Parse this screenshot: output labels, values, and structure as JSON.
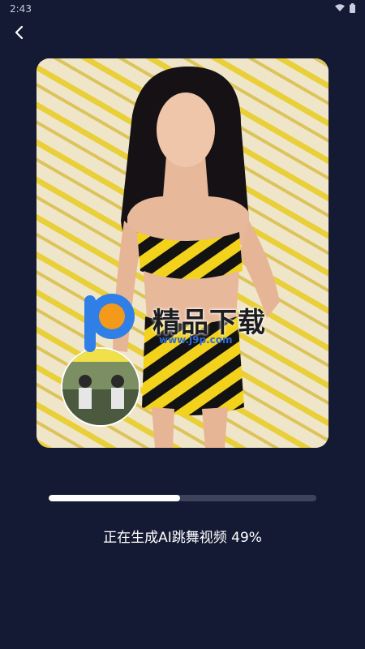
{
  "status_bar": {
    "time": "2:43",
    "icons": [
      "wifi-icon",
      "battery-icon"
    ]
  },
  "nav": {
    "back_icon": "chevron-left-icon"
  },
  "preview": {
    "watermark": {
      "title": "精品下载",
      "url": "www.j9p.com"
    }
  },
  "progress": {
    "label": "正在生成AI跳舞视频 49%",
    "percent": 49
  },
  "colors": {
    "background": "#141a33",
    "track": "#3d435a",
    "fill": "#ffffff",
    "stripe_yellow": "#f2d21b",
    "stripe_black": "#121212"
  }
}
